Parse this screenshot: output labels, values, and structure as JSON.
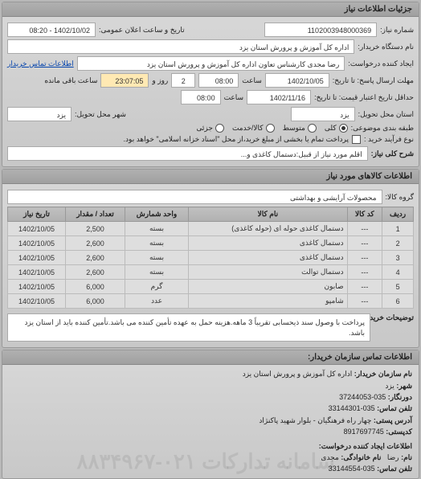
{
  "header": {
    "title": "جزئیات اطلاعات نیاز"
  },
  "top": {
    "req_no_label": "شماره نیاز:",
    "req_no": "1102003948000369",
    "announce_label": "تاریخ و ساعت اعلان عمومی:",
    "announce_date": "1402/10/02 - 08:20",
    "buyer_label": "نام دستگاه خریدار:",
    "buyer": "اداره کل آموزش و پرورش استان یزد",
    "creator_label": "ایجاد کننده درخواست:",
    "creator": "رضا مجدی کارشناس تعاون اداره کل آموزش و پرورش استان یزد",
    "contact_link": "اطلاعات تماس خریدار",
    "deadline_label": "مهلت ارسال پاسخ: تا تاریخ:",
    "deadline_date": "1402/10/05",
    "time_label": "ساعت",
    "deadline_time": "08:00",
    "days_label": "روز و",
    "days": "2",
    "remain_time": "23:07:05",
    "remain_label": "ساعت باقی مانده",
    "valid_label": "حداقل تاریخ اعتبار قیمت: تا تاریخ:",
    "valid_date": "1402/11/16",
    "valid_time": "08:00",
    "province_label": "استان محل تحویل:",
    "province": "یزد",
    "city_label": "شهر محل تحویل:",
    "city": "یزد",
    "class_label": "طبقه بندی موضوعی:",
    "cls_all": "کلی",
    "cls_mid": "متوسط",
    "cls_item": "کالا/خدمت",
    "cls_srv": "جزئی",
    "buy_type_label": "نوع فرآیند خرید :",
    "buy_type_note": "پرداخت تمام یا بخشی از مبلغ خرید،از محل \"اسناد خزانه اسلامی\" خواهد بود.",
    "desc_label": "شرح کلی نیاز:",
    "desc": "اقلم مورد نیاز از قبیل:دستمال کاغذی و..."
  },
  "items": {
    "section_title": "اطلاعات کالاهای مورد نیاز",
    "group_label": "گروه کالا:",
    "group": "محصولات آرایشی و بهداشتی",
    "cols": {
      "row": "ردیف",
      "code": "کد کالا",
      "name": "نام کالا",
      "unit": "واحد شمارش",
      "qty": "تعداد / مقدار",
      "date": "تاریخ نیاز"
    },
    "rows": [
      {
        "row": "1",
        "code": "---",
        "name": "دستمال کاغذی حوله ای (حوله کاغذی)",
        "unit": "بسته",
        "qty": "2,500",
        "date": "1402/10/05"
      },
      {
        "row": "2",
        "code": "---",
        "name": "دستمال کاغذی",
        "unit": "بسته",
        "qty": "2,600",
        "date": "1402/10/05"
      },
      {
        "row": "3",
        "code": "---",
        "name": "دستمال کاغذی",
        "unit": "بسته",
        "qty": "2,600",
        "date": "1402/10/05"
      },
      {
        "row": "4",
        "code": "---",
        "name": "دستمال توالت",
        "unit": "بسته",
        "qty": "2,600",
        "date": "1402/10/05"
      },
      {
        "row": "5",
        "code": "---",
        "name": "صابون",
        "unit": "گرم",
        "qty": "6,000",
        "date": "1402/10/05"
      },
      {
        "row": "6",
        "code": "---",
        "name": "شامپو",
        "unit": "عدد",
        "qty": "6,000",
        "date": "1402/10/05"
      }
    ],
    "note_label": "توضیحات خریدار:",
    "note": "پرداخت با وصول سند ذیحسابی تقریباً 3 ماهه.هزینه حمل به عهده تأمین کننده می باشد.تأمین کننده باید از استان یزد باشد."
  },
  "contact": {
    "section_title": "اطلاعات تماس سازمان خریدار:",
    "org_label": "نام سازمان خریدار:",
    "org": "اداره کل آموزش و پرورش استان یزد",
    "city_label": "شهر:",
    "city": "یزد",
    "fax_label": "دورنگار:",
    "fax": "035-37244053",
    "tel_label": "تلفن تماس:",
    "tel": "035-33144301",
    "addr_label": "آدرس پستی:",
    "addr": "چهار راه فرهنگیان - بلوار شهید پاکنژاد",
    "zip_label": "کدپستی:",
    "zip": "8917697745",
    "creator_section": "اطلاعات ایجاد کننده درخواست:",
    "name_label": "نام:",
    "name": "رضا",
    "lname_label": "نام خانوادگی:",
    "lname": "مجدی",
    "tel2_label": "تلفن تماس:",
    "tel2": "035-33144554"
  },
  "watermark": "سامانه تدارکات ۰۲۱-۸۸۳۴۹۶۷"
}
